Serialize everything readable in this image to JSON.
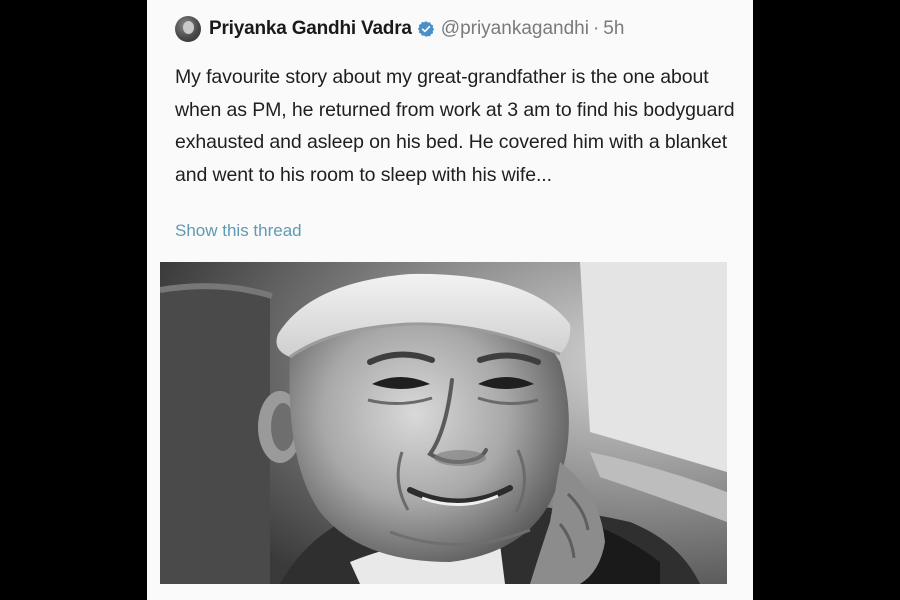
{
  "tweet": {
    "author_name": "Priyanka Gandhi Vadra",
    "handle": "@priyankagandhi",
    "separator": "·",
    "timestamp": "5h",
    "text": "My favourite story about my great-grandfather is the one about when as PM, he returned from work at 3 am to find his bodyguard exhausted and asleep on his bed. He covered him with a blanket and went to his room to sleep with his wife...",
    "show_thread_label": "Show this thread",
    "avatar_icon": "avatar-icon",
    "verified_icon": "verified-badge-icon"
  },
  "colors": {
    "page_background": "#000000",
    "card_background": "#fafafa",
    "link": "#5d9bb2",
    "verified": "#4a90c8"
  }
}
